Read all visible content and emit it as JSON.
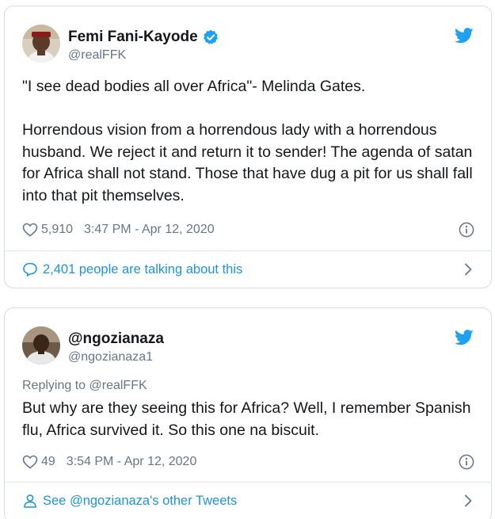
{
  "tweets": [
    {
      "display_name": "Femi Fani-Kayode",
      "handle": "@realFFK",
      "verified": true,
      "text": "\"I see dead bodies all over Africa\"- Melinda Gates.\n\nHorrendous vision from a horrendous lady with a horrendous husband. We reject it and return it to sender! The agenda of satan for Africa shall not stand. Those that have dug a pit for us shall fall into that pit themselves.",
      "likes": "5,910",
      "timestamp": "3:47 PM - Apr 12, 2020",
      "footer": "2,401 people are talking about this"
    },
    {
      "display_name": "@ngozianaza",
      "handle": "@ngozianaza1",
      "verified": false,
      "reply_to": "Replying to @realFFK",
      "text": "But why are they seeing this for Africa? Well, I remember Spanish flu, Africa survived it. So this one na biscuit.",
      "likes": "49",
      "timestamp": "3:54 PM - Apr 12, 2020",
      "footer": "See @ngozianaza's other Tweets"
    }
  ],
  "colors": {
    "twitter_blue": "#1da1f2",
    "link_blue": "#1b95e0",
    "secondary_text": "#657786",
    "border": "#d7dde1"
  },
  "icons": [
    "twitter-bird-icon",
    "verified-badge-icon",
    "heart-icon",
    "info-icon",
    "speech-bubble-icon",
    "person-icon",
    "chevron-right-icon"
  ]
}
